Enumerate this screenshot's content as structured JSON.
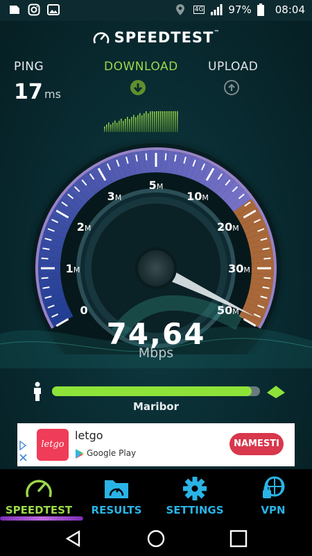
{
  "status_bar": {
    "left_icons": [
      "gallery-icon",
      "instagram-icon",
      "image-icon"
    ],
    "network": "4G",
    "battery": "97%",
    "time": "08:04"
  },
  "app": {
    "title": "SPEEDTEST",
    "trademark": "™"
  },
  "metrics": {
    "ping_label": "PING",
    "ping_value": "17",
    "ping_unit": "ms",
    "download_label": "DOWNLOAD",
    "upload_label": "UPLOAD"
  },
  "gauge": {
    "ticks": [
      {
        "value": "0",
        "suffix": ""
      },
      {
        "value": "1",
        "suffix": "M"
      },
      {
        "value": "2",
        "suffix": "M"
      },
      {
        "value": "3",
        "suffix": "M"
      },
      {
        "value": "5",
        "suffix": "M"
      },
      {
        "value": "10",
        "suffix": "M"
      },
      {
        "value": "20",
        "suffix": "M"
      },
      {
        "value": "30",
        "suffix": "M"
      },
      {
        "value": "50",
        "suffix": "M"
      }
    ],
    "reading": "74,64",
    "unit": "Mbps"
  },
  "progress": {
    "fraction": 0.96,
    "server": "Maribor"
  },
  "ad": {
    "title": "letgo",
    "store": "Google Play",
    "cta": "NAMESTI",
    "logo_text": "letgo"
  },
  "nav": [
    {
      "label": "SPEEDTEST",
      "icon": "speedometer-icon",
      "active": true
    },
    {
      "label": "RESULTS",
      "icon": "results-folder-icon",
      "active": false
    },
    {
      "label": "SETTINGS",
      "icon": "gear-icon",
      "active": false
    },
    {
      "label": "VPN",
      "icon": "vpn-globe-lock-icon",
      "active": false
    }
  ],
  "colors": {
    "accent_green": "#9bd84a",
    "accent_blue": "#2ab3e6",
    "gauge_orange": "#e2894a",
    "ad_button": "#d8374c"
  }
}
